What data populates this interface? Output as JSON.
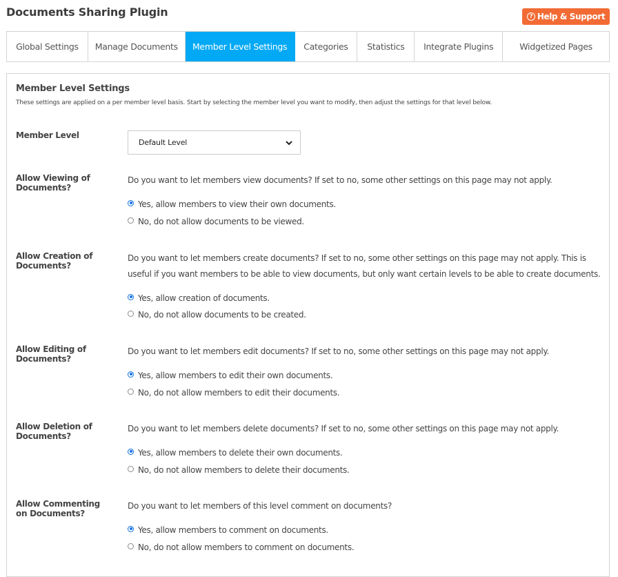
{
  "header": {
    "title": "Documents Sharing Plugin",
    "help_button": {
      "label": "Help & Support",
      "icon": "question-circle-icon",
      "color": "#f26b35"
    }
  },
  "tabs": [
    {
      "label": "Global Settings",
      "active": false
    },
    {
      "label": "Manage Documents",
      "active": false
    },
    {
      "label": "Member Level Settings",
      "active": true
    },
    {
      "label": "Categories",
      "active": false
    },
    {
      "label": "Statistics",
      "active": false
    },
    {
      "label": "Integrate Plugins",
      "active": false
    },
    {
      "label": "Widgetized Pages",
      "active": false
    }
  ],
  "accent_color": "#03a9f4",
  "panel": {
    "title": "Member Level Settings",
    "description": "These settings are applied on a per member level basis. Start by selecting the member level you want to modify, then adjust the settings for that level below.",
    "member_level": {
      "label": "Member Level",
      "selected": "Default Level"
    },
    "settings": [
      {
        "label": "Allow Viewing of Documents?",
        "question": "Do you want to let members view documents? If set to no, some other settings on this page may not apply.",
        "options": [
          {
            "label": "Yes, allow members to view their own documents.",
            "checked": true
          },
          {
            "label": "No, do not allow documents to be viewed.",
            "checked": false
          }
        ]
      },
      {
        "label": "Allow Creation of Documents?",
        "question": "Do you want to let members create documents? If set to no, some other settings on this page may not apply. This is useful if you want members to be able to view documents, but only want certain levels to be able to create documents.",
        "options": [
          {
            "label": "Yes, allow creation of documents.",
            "checked": true
          },
          {
            "label": "No, do not allow documents to be created.",
            "checked": false
          }
        ]
      },
      {
        "label": "Allow Editing of Documents?",
        "question": "Do you want to let members edit documents? If set to no, some other settings on this page may not apply.",
        "options": [
          {
            "label": "Yes, allow members to edit their own documents.",
            "checked": true
          },
          {
            "label": "No, do not allow members to edit their documents.",
            "checked": false
          }
        ]
      },
      {
        "label": "Allow Deletion of Documents?",
        "question": "Do you want to let members delete documents? If set to no, some other settings on this page may not apply.",
        "options": [
          {
            "label": "Yes, allow members to delete their own documents.",
            "checked": true
          },
          {
            "label": "No, do not allow members to delete their documents.",
            "checked": false
          }
        ]
      },
      {
        "label": "Allow Commenting on Documents?",
        "question": "Do you want to let members of this level comment on documents?",
        "options": [
          {
            "label": "Yes, allow members to comment on documents.",
            "checked": true
          },
          {
            "label": "No, do not allow members to comment on documents.",
            "checked": false
          }
        ]
      }
    ]
  }
}
